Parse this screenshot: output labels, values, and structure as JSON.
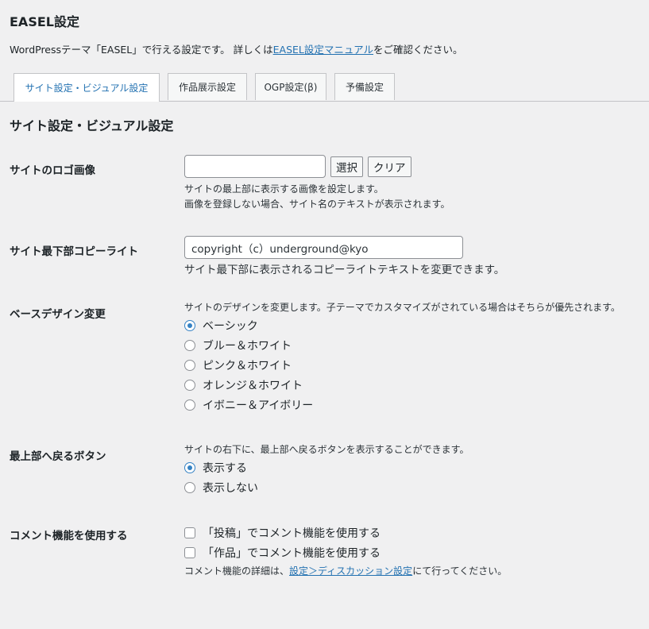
{
  "page": {
    "title": "EASEL設定",
    "intro_before": "WordPressテーマ「EASEL」で行える設定です。 詳しくは",
    "intro_link": "EASEL設定マニュアル",
    "intro_after": "をご確認ください。"
  },
  "tabs": [
    {
      "label": "サイト設定・ビジュアル設定",
      "active": true
    },
    {
      "label": "作品展示設定",
      "active": false
    },
    {
      "label": "OGP設定(β)",
      "active": false
    },
    {
      "label": "予備設定",
      "active": false
    }
  ],
  "section_title": "サイト設定・ビジュアル設定",
  "logo": {
    "label": "サイトのロゴ画像",
    "value": "",
    "select_button": "選択",
    "clear_button": "クリア",
    "desc1": "サイトの最上部に表示する画像を設定します。",
    "desc2": "画像を登録しない場合、サイト名のテキストが表示されます。"
  },
  "copyright": {
    "label": "サイト最下部コピーライト",
    "value": "copyright（c）underground@kyo",
    "desc": "サイト最下部に表示されるコピーライトテキストを変更できます。"
  },
  "base_design": {
    "label": "ベースデザイン変更",
    "desc": "サイトのデザインを変更します。子テーマでカスタマイズがされている場合はそちらが優先されます。",
    "options": [
      {
        "label": "ベーシック",
        "checked": true
      },
      {
        "label": "ブルー＆ホワイト",
        "checked": false
      },
      {
        "label": "ピンク＆ホワイト",
        "checked": false
      },
      {
        "label": "オレンジ＆ホワイト",
        "checked": false
      },
      {
        "label": "イボニー＆アイボリー",
        "checked": false
      }
    ]
  },
  "back_to_top": {
    "label": "最上部へ戻るボタン",
    "desc": "サイトの右下に、最上部へ戻るボタンを表示することができます。",
    "options": [
      {
        "label": "表示する",
        "checked": true
      },
      {
        "label": "表示しない",
        "checked": false
      }
    ]
  },
  "comments": {
    "label": "コメント機能を使用する",
    "options": [
      {
        "label": "「投稿」でコメント機能を使用する",
        "checked": false
      },
      {
        "label": "「作品」でコメント機能を使用する",
        "checked": false
      }
    ],
    "note_before": "コメント機能の詳細は、",
    "note_link": "設定＞ディスカッション設定",
    "note_after": "にて行ってください。"
  },
  "colors": {
    "background": "#f0f0f1",
    "link": "#2271b1",
    "radio_checked": "#3582c4"
  }
}
